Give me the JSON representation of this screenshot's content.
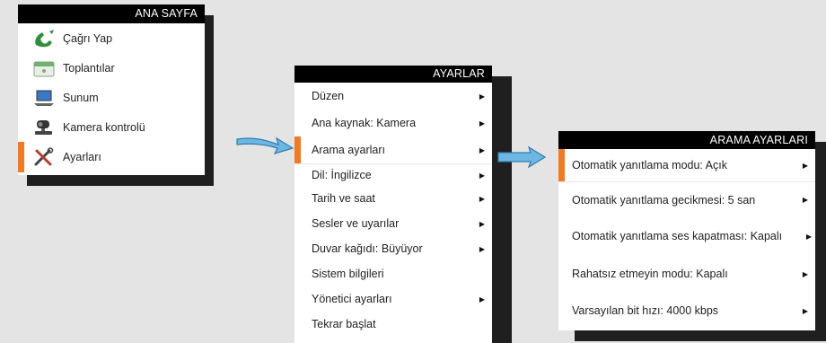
{
  "panel1": {
    "title": "ANA SAYFA",
    "items": [
      {
        "label": "Çağrı Yap",
        "icon": "phone-icon"
      },
      {
        "label": "Toplantılar",
        "icon": "calendar-icon"
      },
      {
        "label": "Sunum",
        "icon": "laptop-icon"
      },
      {
        "label": "Kamera kontrolü",
        "icon": "camera-icon"
      },
      {
        "label": "Ayarları",
        "icon": "tools-icon",
        "selected": true
      }
    ]
  },
  "panel2": {
    "title": "AYARLAR",
    "items": [
      {
        "label": "Düzen",
        "arrow": "▶"
      },
      {
        "label": "Ana kaynak: Kamera",
        "arrow": "▶"
      },
      {
        "label": "Arama ayarları",
        "arrow": "▶",
        "selected": true
      },
      {
        "label": "Dil: İngilizce",
        "arrow": "▶"
      },
      {
        "label": "Tarih ve saat",
        "arrow": "▶"
      },
      {
        "label": "Sesler ve uyarılar",
        "arrow": "▶"
      },
      {
        "label": "Duvar kağıdı: Büyüyor",
        "arrow": "▶"
      },
      {
        "label": "Sistem bilgileri"
      },
      {
        "label": "Yönetici ayarları",
        "arrow": "▶"
      },
      {
        "label": "Tekrar başlat"
      }
    ]
  },
  "panel3": {
    "title": "ARAMA AYARLARI",
    "items": [
      {
        "label": "Otomatik yanıtlama modu: Açık",
        "arrow": "▶",
        "selected": true
      },
      {
        "label": "Otomatik yanıtlama gecikmesi: 5 san",
        "arrow": "▶"
      },
      {
        "label": "Otomatik yanıtlama ses kapatması: Kapalı",
        "arrow": "▶"
      },
      {
        "label": "Rahatsız etmeyin modu: Kapalı",
        "arrow": "▶"
      },
      {
        "label": "Varsayılan bit hızı: 4000 kbps",
        "arrow": "▶"
      }
    ]
  },
  "colors": {
    "accent": "#f47a20",
    "arrow": "#4aa3d8",
    "shadow": "#1f1f1f"
  }
}
